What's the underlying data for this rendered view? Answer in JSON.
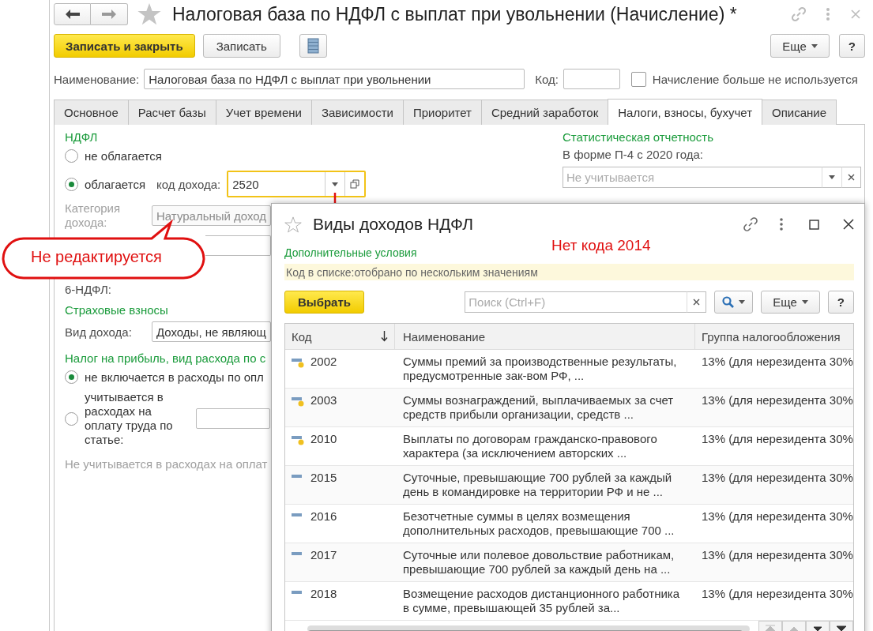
{
  "window": {
    "title": "Налоговая база по НДФЛ с выплат при увольнении (Начисление) *"
  },
  "toolbar": {
    "primary": "Записать и закрыть",
    "save": "Записать",
    "more": "Еще",
    "help": "?"
  },
  "header": {
    "name_label": "Наименование:",
    "name_value": "Налоговая база по НДФЛ с выплат при увольнении",
    "code_label": "Код:",
    "unused_label": "Начисление больше не используется",
    "unused_checked": false
  },
  "tabs": [
    {
      "label": "Основное",
      "selected": false
    },
    {
      "label": "Расчет базы",
      "selected": false
    },
    {
      "label": "Учет времени",
      "selected": false
    },
    {
      "label": "Зависимости",
      "selected": false
    },
    {
      "label": "Приоритет",
      "selected": false
    },
    {
      "label": "Средний заработок",
      "selected": false
    },
    {
      "label": "Налоги, взносы, бухучет",
      "selected": true
    },
    {
      "label": "Описание",
      "selected": false
    }
  ],
  "ndfl": {
    "title": "НДФЛ",
    "options": [
      {
        "label": "не облагается",
        "selected": false
      },
      {
        "label": "облагается",
        "selected": true
      }
    ],
    "income_code_label": "код дохода:",
    "income_code_value": "2520",
    "income_code_focused": true,
    "category_label": "Категория дохода:",
    "category_value": "Натуральный доход",
    "category_disabled": true,
    "report_label": "6-НДФЛ:"
  },
  "insurance": {
    "title": "Страховые взносы",
    "income_type_label": "Вид дохода:",
    "income_type_value": "Доходы, не являющ"
  },
  "profit_tax": {
    "title": "Налог на прибыль, вид расхода по с",
    "options": [
      {
        "label": "не включается в расходы по опл",
        "selected": true
      },
      {
        "label": "учитывается в расходах на оплату труда по статье:",
        "selected": false
      }
    ],
    "note": "Не учитывается в расходах на оплат"
  },
  "statistics": {
    "title": "Статистическая отчетность",
    "form_label": "В форме П-4 с 2020 года:",
    "form_placeholder": "Не учитывается"
  },
  "callout": "Не редактируется",
  "dialog": {
    "title": "Виды доходов НДФЛ",
    "annotation": "Нет кода 2014",
    "conditions_title": "Дополнительные условия",
    "filter": "Код в списке:отобрано по нескольким значениям",
    "select_button": "Выбрать",
    "search_placeholder": "Поиск (Ctrl+F)",
    "more": "Еще",
    "help": "?",
    "columns": [
      "Код",
      "Наименование",
      "Группа налогообложения"
    ],
    "rows": [
      {
        "kind": "predefined",
        "code": "2002",
        "name": "Суммы премий за производственные результаты, предусмотренные зак-вом РФ, ...",
        "group": "13% (для нерезидента 30%"
      },
      {
        "kind": "predefined",
        "code": "2003",
        "name": "Суммы вознаграждений, выплачиваемых за счет средств прибыли организации, средств ...",
        "group": "13% (для нерезидента 30%"
      },
      {
        "kind": "predefined",
        "code": "2010",
        "name": "Выплаты по договорам гражданско-правового характера (за исключением авторских ...",
        "group": "13% (для нерезидента 30%"
      },
      {
        "kind": "regular",
        "code": "2015",
        "name": "Суточные, превышающие 700 рублей за каждый день в командировке на территории РФ и не ...",
        "group": "13% (для нерезидента 30%"
      },
      {
        "kind": "regular",
        "code": "2016",
        "name": "Безотчетные суммы в целях возмещения дополнительных расходов, превышающие 700 ...",
        "group": "13% (для нерезидента 30%"
      },
      {
        "kind": "regular",
        "code": "2017",
        "name": "Суточные или полевое довольствие работникам, превышающие 700 рублей за каждый день на ...",
        "group": "13% (для нерезидента 30%"
      },
      {
        "kind": "regular",
        "code": "2018",
        "name": "Возмещение расходов дистанционного работника в сумме, превышающей 35 рублей за...",
        "group": "13% (для нерезидента 30%"
      }
    ]
  }
}
